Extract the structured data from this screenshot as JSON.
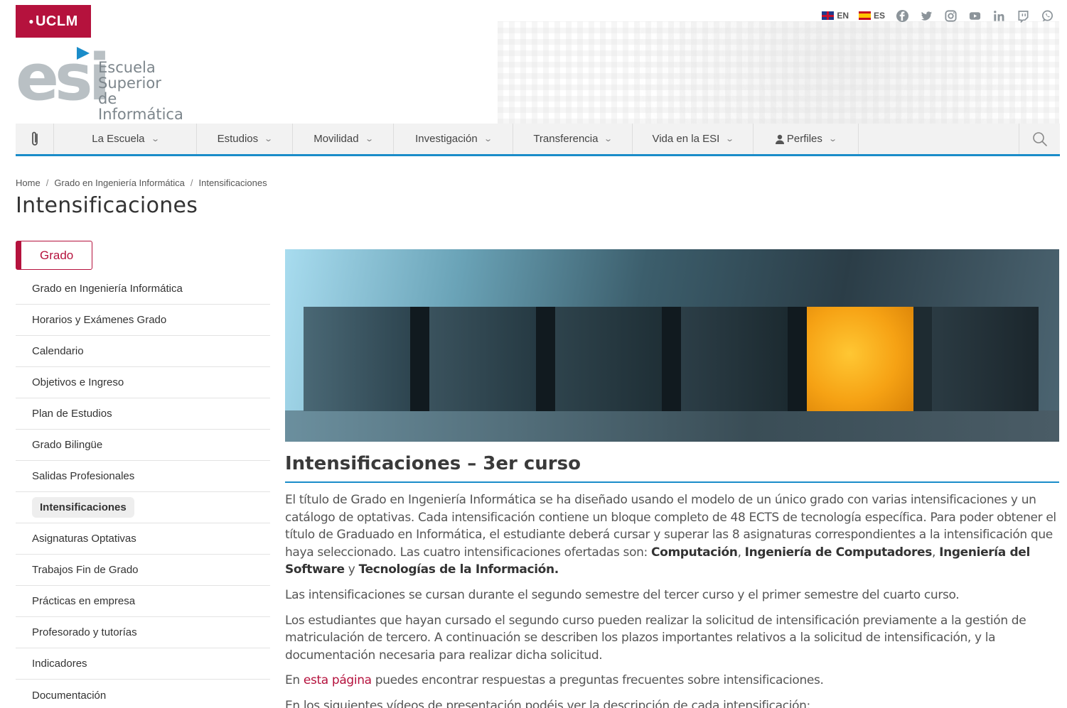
{
  "header": {
    "uclm_logo": "UCLM",
    "esi_logo_word": "esi",
    "esi_text": [
      "Escuela",
      "Superior",
      "de Informática"
    ],
    "lang": [
      {
        "code": "EN"
      },
      {
        "code": "ES"
      }
    ],
    "social_icons": [
      "facebook-icon",
      "twitter-icon",
      "instagram-icon",
      "youtube-icon",
      "linkedin-icon",
      "twitch-icon",
      "whatsapp-icon"
    ]
  },
  "nav": {
    "items": [
      {
        "label": "La Escuela"
      },
      {
        "label": "Estudios"
      },
      {
        "label": "Movilidad"
      },
      {
        "label": "Investigación"
      },
      {
        "label": "Transferencia"
      },
      {
        "label": "Vida en la ESI"
      },
      {
        "label": "Perfiles"
      }
    ]
  },
  "breadcrumb": [
    "Home",
    "Grado en Ingeniería Informática",
    "Intensificaciones"
  ],
  "page_title": "Intensificaciones",
  "sidebar": {
    "heading": "Grado",
    "items": [
      "Grado en Ingeniería Informática",
      "Horarios y Exámenes Grado",
      "Calendario",
      "Objetivos e Ingreso",
      "Plan de Estudios",
      "Grado Bilingüe",
      "Salidas Profesionales",
      "Intensificaciones",
      "Asignaturas Optativas",
      "Trabajos Fin de Grado",
      "Prácticas en empresa",
      "Profesorado y tutorías",
      "Indicadores",
      "Documentación"
    ],
    "active_index": 7
  },
  "main": {
    "section_title": "Intensificaciones – 3er curso",
    "p1_text": "El título de Grado en Ingeniería Informática se ha diseñado usando el modelo de un único grado con varias intensificaciones y un catálogo de optativas. Cada intensificación contiene un bloque completo de 48 ECTS de tecnología específica. Para poder obtener el título de Graduado en Informática, el estudiante deberá cursar y superar las 8 asignaturas correspondientes a la intensificación que haya seleccionado. Las cuatro intensificaciones ofertadas son: ",
    "p1_bold": [
      "Computación",
      "Ingeniería de Computadores",
      "Ingeniería del Software",
      "Tecnologías de la Información."
    ],
    "p1_sep": [
      ", ",
      ", ",
      " y "
    ],
    "p2": "Las intensificaciones se cursan durante el segundo semestre del tercer curso y el primer semestre del cuarto curso.",
    "p3": "Los estudiantes que hayan cursado el segundo curso pueden realizar la solicitud de intensificación previamente a la gestión de matriculación de tercero. A continuación se describen los plazos importantes relativos a la solicitud de intensificación, y la documentación necesaria para realizar dicha solicitud.",
    "p4_pre": "En ",
    "p4_link": "esta página",
    "p4_post": " puedes encontrar respuestas a preguntas frecuentes sobre intensificaciones.",
    "p5": "En los siguientes vídeos de presentación podéis ver la descripción de cada intensificación:"
  },
  "colors": {
    "brand_red": "#b5123d",
    "accent_blue": "#1a8cc9",
    "highlight_cube": "#f6a214"
  }
}
